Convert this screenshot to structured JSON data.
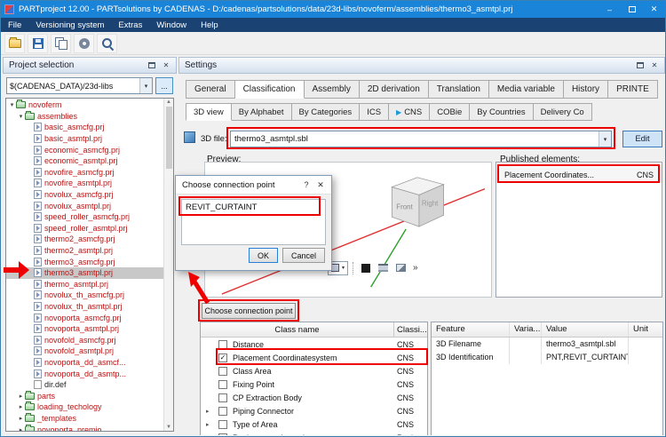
{
  "titlebar": {
    "title": "PARTproject 12.00 - PARTsolutions by CADENAS - D:/cadenas/partsolutions/data/23d-libs/novoferm/assemblies/thermo3_asmtpl.prj"
  },
  "menu_bar": [
    "File",
    "Versioning system",
    "Extras",
    "Window",
    "Help"
  ],
  "toolbar": [
    "open-project-icon",
    "save-icon",
    "copy-icon",
    "settings-icon",
    "search-icon"
  ],
  "project_selection": {
    "title": "Project selection",
    "path_value": "$(CADENAS_DATA)/23d-libs",
    "browse_label": "...",
    "tree": [
      {
        "label": "novoferm",
        "level": 0,
        "type": "folder",
        "expanded": true
      },
      {
        "label": "assemblies",
        "level": 1,
        "type": "folder",
        "expanded": true
      },
      {
        "label": "basic_asmcfg.prj",
        "level": 2,
        "type": "prj"
      },
      {
        "label": "basic_asmtpl.prj",
        "level": 2,
        "type": "prj"
      },
      {
        "label": "economic_asmcfg.prj",
        "level": 2,
        "type": "prj"
      },
      {
        "label": "economic_asmtpl.prj",
        "level": 2,
        "type": "prj"
      },
      {
        "label": "novofire_asmcfg.prj",
        "level": 2,
        "type": "prj"
      },
      {
        "label": "novofire_asmtpl.prj",
        "level": 2,
        "type": "prj"
      },
      {
        "label": "novolux_asmcfg.prj",
        "level": 2,
        "type": "prj"
      },
      {
        "label": "novolux_asmtpl.prj",
        "level": 2,
        "type": "prj"
      },
      {
        "label": "speed_roller_asmcfg.prj",
        "level": 2,
        "type": "prj"
      },
      {
        "label": "speed_roller_asmtpl.prj",
        "level": 2,
        "type": "prj"
      },
      {
        "label": "thermo2_asmcfg.prj",
        "level": 2,
        "type": "prj"
      },
      {
        "label": "thermo2_asmtpl.prj",
        "level": 2,
        "type": "prj"
      },
      {
        "label": "thermo3_asmcfg.prj",
        "level": 2,
        "type": "prj"
      },
      {
        "label": "thermo3_asmtpl.prj",
        "level": 2,
        "type": "prj",
        "selected": true
      },
      {
        "label": "thermo_asmtpl.prj",
        "level": 2,
        "type": "prj"
      },
      {
        "label": "novolux_th_asmcfg.prj",
        "level": 2,
        "type": "prj"
      },
      {
        "label": "novolux_th_asmtpl.prj",
        "level": 2,
        "type": "prj"
      },
      {
        "label": "novoporta_asmcfg.prj",
        "level": 2,
        "type": "prj"
      },
      {
        "label": "novoporta_asmtpl.prj",
        "level": 2,
        "type": "prj"
      },
      {
        "label": "novofold_asmcfg.prj",
        "level": 2,
        "type": "prj"
      },
      {
        "label": "novofold_asmtpl.prj",
        "level": 2,
        "type": "prj"
      },
      {
        "label": "novoporta_dd_asmcf...",
        "level": 2,
        "type": "prj"
      },
      {
        "label": "novoporta_dd_asmtp...",
        "level": 2,
        "type": "prj"
      },
      {
        "label": "dir.def",
        "level": 2,
        "type": "file",
        "black": true
      },
      {
        "label": "parts",
        "level": 1,
        "type": "folder",
        "expanded": false
      },
      {
        "label": "loading_techology",
        "level": 1,
        "type": "folder",
        "expanded": false
      },
      {
        "label": "_templates",
        "level": 1,
        "type": "folder",
        "expanded": false
      },
      {
        "label": "novoporta_premio",
        "level": 1,
        "type": "folder",
        "expanded": false
      }
    ]
  },
  "settings": {
    "title": "Settings",
    "tabs": [
      "General",
      "Classification",
      "Assembly",
      "2D derivation",
      "Translation",
      "Media variable",
      "History",
      "PRINTE"
    ],
    "active_tab": "Classification",
    "subtabs": [
      "3D view",
      "By Alphabet",
      "By Categories",
      "ICS",
      "CNS",
      "COBie",
      "By Countries",
      "Delivery Co"
    ],
    "active_subtab": "3D view",
    "file_row": {
      "label": "3D file:",
      "value": "thermo3_asmtpl.sbl",
      "edit_label": "Edit"
    },
    "preview_label": "Preview:",
    "viewport": {
      "cube_front": "Front",
      "cube_right": "Right"
    },
    "published": {
      "label": "Published elements:",
      "items": [
        {
          "name": "Placement Coordinates...",
          "cls": "CNS"
        }
      ]
    },
    "choose_button": "Choose connection point"
  },
  "dialog": {
    "title": "Choose connection point",
    "selected_value": "REVIT_CURTAINT",
    "ok": "OK",
    "cancel": "Cancel"
  },
  "class_table": {
    "headers": [
      "Class name",
      "Classi..."
    ],
    "rows": [
      {
        "name": "Distance",
        "cls": "CNS",
        "checked": false,
        "expander": false
      },
      {
        "name": "Placement Coordinatesystem",
        "cls": "CNS",
        "checked": true,
        "expander": false,
        "highlighted": true
      },
      {
        "name": "Class Area",
        "cls": "CNS",
        "checked": false,
        "expander": false
      },
      {
        "name": "Fixing Point",
        "cls": "CNS",
        "checked": false,
        "expander": false
      },
      {
        "name": "CP Extraction Body",
        "cls": "CNS",
        "checked": false,
        "expander": false
      },
      {
        "name": "Piping Connector",
        "cls": "CNS",
        "checked": false,
        "expander": true
      },
      {
        "name": "Type of Area",
        "cls": "CNS",
        "checked": false,
        "expander": true
      },
      {
        "name": "Revit connection points",
        "cls": "Revit",
        "checked": false,
        "expander": true
      }
    ]
  },
  "feature_table": {
    "headers": [
      "Feature",
      "Varia...",
      "Value",
      "Unit"
    ],
    "rows": [
      {
        "feature": "3D Filename",
        "variable": "",
        "value": "thermo3_asmtpl.sbl",
        "unit": ""
      },
      {
        "feature": "3D Identification",
        "variable": "",
        "value": "PNT,REVIT_CURTAINT",
        "unit": ""
      }
    ]
  },
  "icons": {
    "dropdown": "▾",
    "collapsed": "▸",
    "expanded": "▾",
    "play": "▶",
    "check": "✓",
    "close": "✕",
    "help": "?",
    "minimize": "–",
    "chevron_more": "»",
    "scroll_up": "▲",
    "scroll_down": "▼"
  },
  "colors": {
    "titlebar": "#1984d8",
    "menubar": "#1a4373",
    "annotation": "#ee0000",
    "tree_text": "#bb1111"
  }
}
